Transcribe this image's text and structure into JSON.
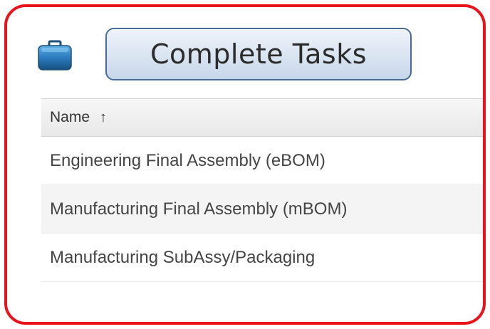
{
  "header": {
    "icon": "briefcase-icon",
    "title": "Complete Tasks"
  },
  "table": {
    "columns": [
      {
        "label": "Name",
        "sort": "ascending"
      }
    ],
    "rows": [
      "Engineering Final Assembly (eBOM)",
      "Manufacturing Final Assembly (mBOM)",
      "Manufacturing SubAssy/Packaging"
    ]
  },
  "colors": {
    "frame_border": "#e8131b",
    "button_border": "#4a6a96",
    "icon_blue": "#2b7bbf"
  }
}
